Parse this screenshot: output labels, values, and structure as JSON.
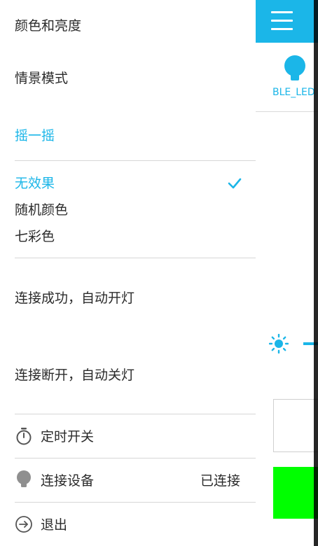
{
  "app": {
    "device_name": "BLE_LED",
    "colors": {
      "accent": "#1bb6e8",
      "green_swatch": "#00ff00"
    }
  },
  "drawer": {
    "color_brightness": "颜色和亮度",
    "scene_mode": "情景模式",
    "shake_title": "摇一摇",
    "shake_options": [
      {
        "label": "无效果",
        "selected": true
      },
      {
        "label": "随机颜色",
        "selected": false
      },
      {
        "label": "七彩色",
        "selected": false
      }
    ],
    "connect_on": "连接成功，自动开灯",
    "disconnect_off": "连接断开，自动关灯",
    "timer": {
      "label": "定时开关",
      "icon": "timer-icon"
    },
    "connect_device": {
      "label": "连接设备",
      "status": "已连接",
      "icon": "bulb-icon"
    },
    "exit": {
      "label": "退出",
      "icon": "exit-icon"
    }
  }
}
